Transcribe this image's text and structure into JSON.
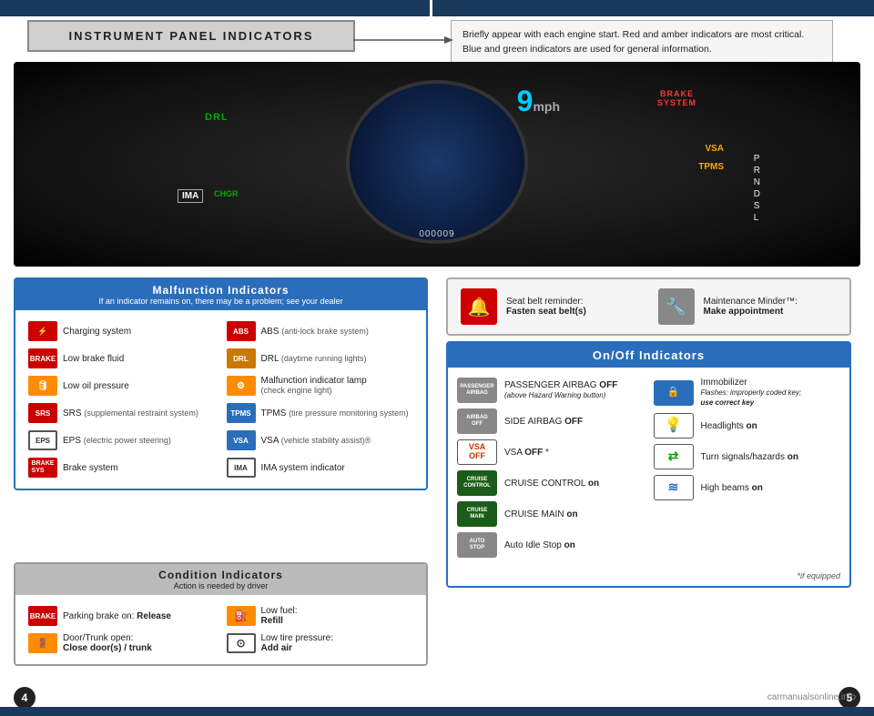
{
  "header": {
    "title": "INSTRUMENT PANEL INDICATORS",
    "description_line1": "Briefly appear with each engine start. Red and amber indicators are most critical.",
    "description_line2": "Blue and green indicators are used for general information."
  },
  "malfunction_section": {
    "title": "Malfunction Indicators",
    "subtitle": "If an indicator remains on, there may be a problem; see your dealer",
    "items_left": [
      {
        "icon": "⚡",
        "icon_type": "red",
        "icon_label": "",
        "label": "Charging system"
      },
      {
        "icon": "BRAKE",
        "icon_type": "red-text",
        "icon_label": "BRAKE",
        "label": "Low brake fluid"
      },
      {
        "icon": "🛢",
        "icon_type": "red",
        "icon_label": "",
        "label": "Low oil pressure"
      },
      {
        "icon": "SRS",
        "icon_type": "red-text",
        "icon_label": "SRS",
        "label": "SRS (supplemental restraint system)"
      },
      {
        "icon": "EPS",
        "icon_type": "outline",
        "icon_label": "EPS",
        "label": "EPS (electric power steering)"
      },
      {
        "icon": "BRAKE",
        "icon_type": "brake-sys",
        "icon_label": "BRAKE SYSTEM",
        "label": "Brake system"
      }
    ],
    "items_right": [
      {
        "icon": "ABS",
        "icon_type": "outline-circle",
        "icon_label": "ABS",
        "label": "ABS",
        "sublabel": "(anti-lock brake system)"
      },
      {
        "icon": "DRL",
        "icon_type": "drl",
        "icon_label": "DRL",
        "label": "DRL",
        "sublabel": "(daytime running lights)"
      },
      {
        "icon": "⚙",
        "icon_type": "amber",
        "icon_label": "",
        "label": "Malfunction indicator lamp",
        "sublabel": "(check engine light)"
      },
      {
        "icon": "TPMS",
        "icon_type": "tpms",
        "icon_label": "TPMS",
        "label": "TPMS",
        "sublabel": "(tire pressure monitoring system)"
      },
      {
        "icon": "VSA",
        "icon_type": "vsa",
        "icon_label": "VSA",
        "label": "VSA",
        "sublabel": "(vehicle stability assist)®"
      },
      {
        "icon": "IMA",
        "icon_type": "ima",
        "icon_label": "IMA",
        "label": "IMA system indicator"
      }
    ]
  },
  "condition_section": {
    "title": "Condition Indicators",
    "subtitle": "Action is needed by driver",
    "items": [
      {
        "icon_label": "BRAKE",
        "icon_type": "red",
        "label_normal": "Parking brake on:",
        "label_bold": "Release"
      },
      {
        "icon_label": "⛽",
        "icon_type": "amber",
        "label_normal": "Low fuel:",
        "label_bold": "Refill"
      },
      {
        "icon_label": "🚪",
        "icon_type": "amber",
        "label_normal": "Door/Trunk open:",
        "label_bold": "Close door(s) / trunk"
      },
      {
        "icon_label": "⊙",
        "icon_type": "outline",
        "label_normal": "Low tire pressure:",
        "label_bold": "Add air"
      }
    ]
  },
  "seatbelt_section": {
    "seatbelt_label": "Seat belt reminder:",
    "seatbelt_action": "Fasten seat belt(s)",
    "maintenance_label": "Maintenance Minder™:",
    "maintenance_action": "Make appointment"
  },
  "onoff_section": {
    "title": "On/Off Indicators",
    "items_left": [
      {
        "icon_label": "PASSENGER\nAIRBAG",
        "icon_type": "airbag",
        "label": "PASSENGER AIRBAG OFF",
        "sublabel": "(above Hazard Warning button)"
      },
      {
        "icon_label": "SIDE\nAIRBAG",
        "icon_type": "side-airbag",
        "label": "SIDE AIRBAG OFF",
        "sublabel": ""
      },
      {
        "icon_label": "VSA\nOFF",
        "icon_type": "vsa",
        "label": "VSA OFF *",
        "sublabel": ""
      },
      {
        "icon_label": "CRUISE\nCONTROL",
        "icon_type": "cruise-ctrl",
        "label": "CRUISE CONTROL on",
        "sublabel": ""
      },
      {
        "icon_label": "CRUISE\nMAIN",
        "icon_type": "cruise-main",
        "label": "CRUISE MAIN on",
        "sublabel": ""
      },
      {
        "icon_label": "AUTO\nSTOP",
        "icon_type": "auto-stop",
        "label": "Auto Idle Stop on",
        "sublabel": ""
      }
    ],
    "items_right": [
      {
        "icon_label": "🔒",
        "icon_type": "immobilizer",
        "label": "Immobilizer",
        "sublabel": "Flashes: improperly coded key; use correct key"
      },
      {
        "icon_label": "💡💡",
        "icon_type": "headlights",
        "label": "Headlights on",
        "sublabel": ""
      },
      {
        "icon_label": "↩↪",
        "icon_type": "turn-signals",
        "label": "Turn signals/hazards on",
        "sublabel": ""
      },
      {
        "icon_label": "≋",
        "icon_type": "high-beams",
        "label": "High beams on",
        "sublabel": ""
      }
    ],
    "footnote": "*if equipped"
  },
  "pages": {
    "left": "4",
    "right": "5"
  },
  "website": "carmanualsonline.info"
}
